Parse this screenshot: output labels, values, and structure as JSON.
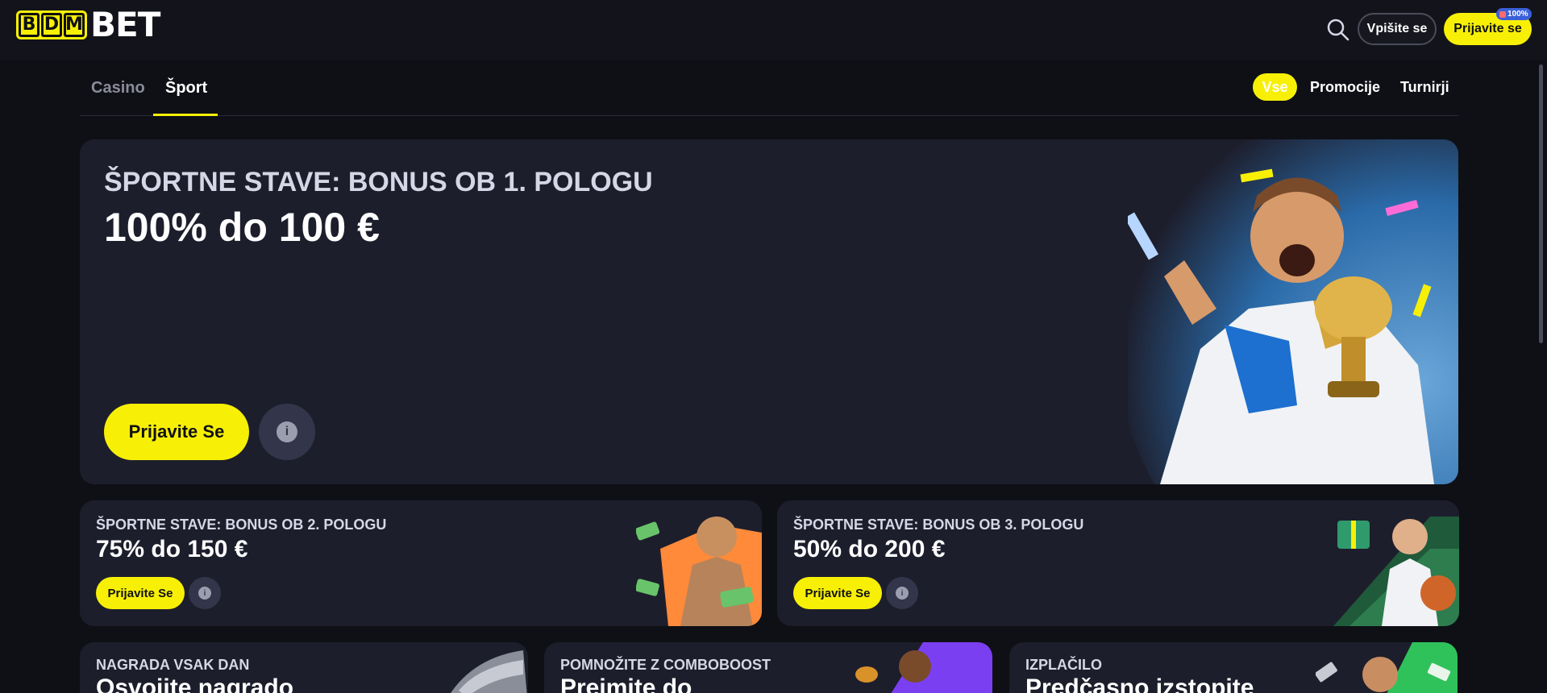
{
  "header": {
    "logo_letters": [
      "B",
      "D",
      "M"
    ],
    "logo_word": "BET",
    "login_label": "Vpišite se",
    "register_label": "Prijavite se",
    "register_badge": "100%"
  },
  "nav": {
    "tabs": [
      {
        "label": "Casino",
        "active": false
      },
      {
        "label": "Šport",
        "active": true
      }
    ],
    "filters": [
      {
        "label": "Vse",
        "active": true
      },
      {
        "label": "Promocije",
        "active": false
      },
      {
        "label": "Turnirji",
        "active": false
      }
    ]
  },
  "hero": {
    "subtitle": "ŠPORTNE STAVE: BONUS OB 1. POLOGU",
    "title": "100% do 100 €",
    "button": "Prijavite Se",
    "info_icon": "i"
  },
  "promos": [
    {
      "subtitle": "ŠPORTNE STAVE: BONUS OB 2. POLOGU",
      "title": "75% do 150 €",
      "button": "Prijavite Se",
      "info_icon": "i"
    },
    {
      "subtitle": "ŠPORTNE STAVE: BONUS OB 3. POLOGU",
      "title": "50% do 200 €",
      "button": "Prijavite Se",
      "info_icon": "i"
    }
  ],
  "bottom_cards": [
    {
      "subtitle": "NAGRADA VSAK DAN",
      "title": "Osvojite nagrado"
    },
    {
      "subtitle": "POMNOŽITE Z COMBOBOOST",
      "title": "Preimite do"
    },
    {
      "subtitle": "IZPLAČILO",
      "title": "Predčasno izstopite"
    }
  ],
  "colors": {
    "accent": "#f7f006",
    "background": "#0f1016",
    "header_bg": "#13141b",
    "card_bg": "#1d1e2c"
  },
  "icons": {
    "search": "search-icon",
    "info": "info-icon",
    "gift": "gift-icon"
  }
}
